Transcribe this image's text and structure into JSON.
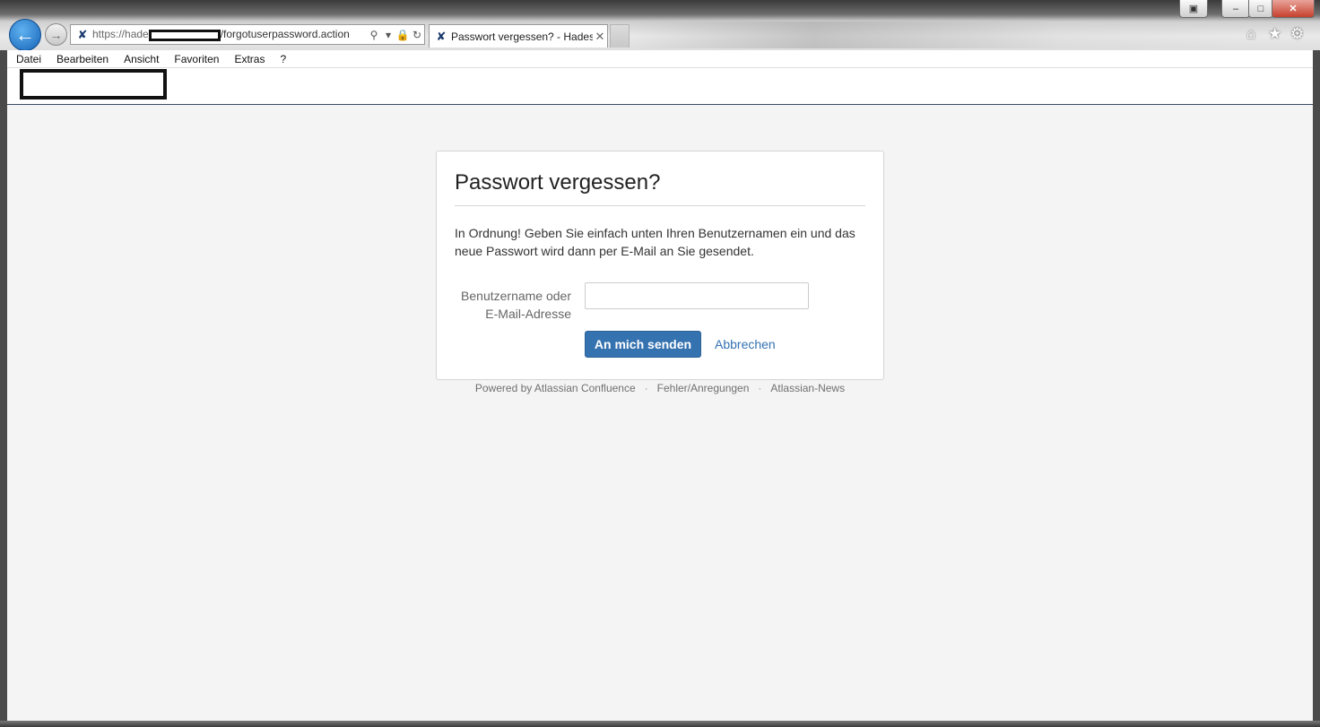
{
  "browser": {
    "window_buttons": {
      "restore_extra": "▣",
      "minimize": "–",
      "maximize": "□",
      "close": "✕"
    },
    "address": {
      "url_start": "https://hade",
      "url_end": "/forgotuserpassword.action"
    },
    "tab": {
      "title": "Passwort vergessen? - Hades",
      "close": "✕"
    },
    "toolbar_icons": [
      "home-icon",
      "favorites-star-icon",
      "settings-gear-icon"
    ]
  },
  "menu": {
    "items": [
      "Datei",
      "Bearbeiten",
      "Ansicht",
      "Favoriten",
      "Extras",
      "?"
    ]
  },
  "page": {
    "title": "Passwort vergessen?",
    "description": "In Ordnung! Geben Sie einfach unten Ihren Benutzernamen ein und das neue Passwort wird dann per E-Mail an Sie gesendet.",
    "username_label_line1": "Benutzername oder",
    "username_label_line2": "E-Mail-Adresse",
    "username_value": "",
    "submit_label": "An mich senden",
    "cancel_label": "Abbrechen"
  },
  "footer": {
    "powered_by": "Powered by Atlassian Confluence",
    "separator": "·",
    "feedback": "Fehler/Anregungen",
    "news": "Atlassian-News"
  },
  "colors": {
    "primary_button": "#3572b0",
    "link": "#3572b0",
    "page_background": "#f4f4f4",
    "header_border": "#3b4a63"
  }
}
